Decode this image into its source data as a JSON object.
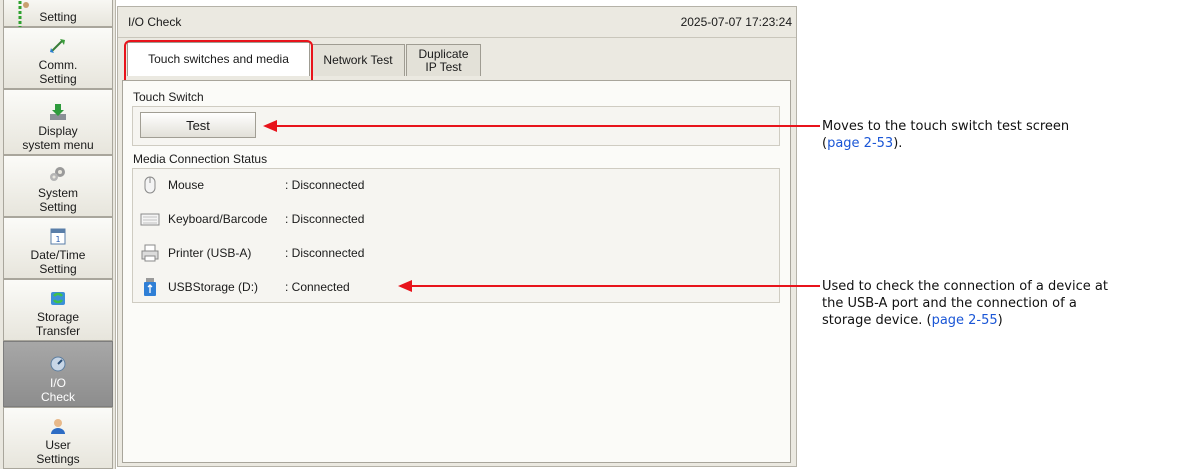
{
  "sidebar": {
    "items": [
      {
        "label": "Setting",
        "icon": "transfer-icon"
      },
      {
        "label": "Comm.\nSetting",
        "icon": "communication-icon"
      },
      {
        "label": "Display\nsystem menu",
        "icon": "download-arrow-icon"
      },
      {
        "label": "System\nSetting",
        "icon": "gear-icon"
      },
      {
        "label": "Date/Time\nSetting",
        "icon": "calendar-icon"
      },
      {
        "label": "Storage\nTransfer",
        "icon": "storage-transfer-icon"
      },
      {
        "label": "I/O\nCheck",
        "icon": "io-check-icon",
        "active": true
      },
      {
        "label": "User\nSettings",
        "icon": "user-icon"
      }
    ]
  },
  "window": {
    "title": "I/O Check",
    "datetime": "2025-07-07  17:23:24"
  },
  "tabs": [
    {
      "label": "Touch switches and media",
      "selected": true
    },
    {
      "label": "Network Test"
    },
    {
      "label": "Duplicate\nIP Test"
    }
  ],
  "touch_switch": {
    "section_label": "Touch Switch",
    "test_button": "Test"
  },
  "media": {
    "section_label": "Media Connection Status",
    "devices": [
      {
        "name": "Mouse",
        "status": ": Disconnected",
        "icon": "mouse-icon"
      },
      {
        "name": "Keyboard/Barcode",
        "status": ": Disconnected",
        "icon": "keyboard-icon"
      },
      {
        "name": "Printer (USB-A)",
        "status": ": Disconnected",
        "icon": "printer-icon"
      },
      {
        "name": "USBStorage (D:)",
        "status": ": Connected",
        "icon": "usb-storage-icon"
      }
    ]
  },
  "annotations": {
    "test_note": {
      "text": "Moves to the touch switch test screen",
      "link": "page 2-53",
      "suffix": ")."
    },
    "media_note": {
      "line1": "Used to check the connection of a device at",
      "line2": "the USB-A port and the connection of a",
      "line3_prefix": "storage device. (",
      "link": "page 2-55",
      "suffix": ")"
    }
  },
  "colors": {
    "highlight": "#e8131b",
    "link": "#1a56d6",
    "active_sidebar": "#999999"
  }
}
